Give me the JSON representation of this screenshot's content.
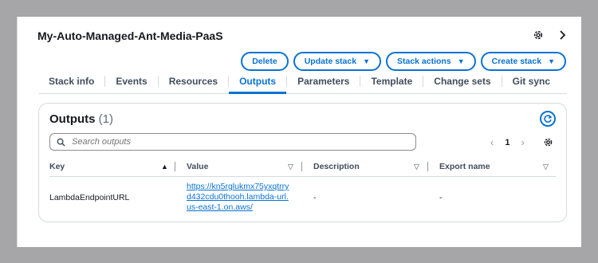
{
  "stack": {
    "title": "My-Auto-Managed-Ant-Media-PaaS"
  },
  "actions": {
    "delete": "Delete",
    "update": "Update stack",
    "stack_actions": "Stack actions",
    "create": "Create stack"
  },
  "tabs": [
    {
      "label": "Stack info"
    },
    {
      "label": "Events"
    },
    {
      "label": "Resources"
    },
    {
      "label": "Outputs",
      "active": true
    },
    {
      "label": "Parameters"
    },
    {
      "label": "Template"
    },
    {
      "label": "Change sets"
    },
    {
      "label": "Git sync"
    }
  ],
  "outputs": {
    "title": "Outputs",
    "count": "(1)",
    "search_placeholder": "Search outputs",
    "page": "1",
    "columns": {
      "key": "Key",
      "value": "Value",
      "description": "Description",
      "export_name": "Export name"
    },
    "rows": [
      {
        "key": "LambdaEndpointURL",
        "value": "https://kn5rglukmx75yxqtrryd432cdu0thooh.lambda-url.us-east-1.on.aws/",
        "description": "-",
        "export_name": "-"
      }
    ]
  },
  "colors": {
    "accent": "#0972d3",
    "text": "#16191f",
    "border": "#d5dbdb"
  }
}
